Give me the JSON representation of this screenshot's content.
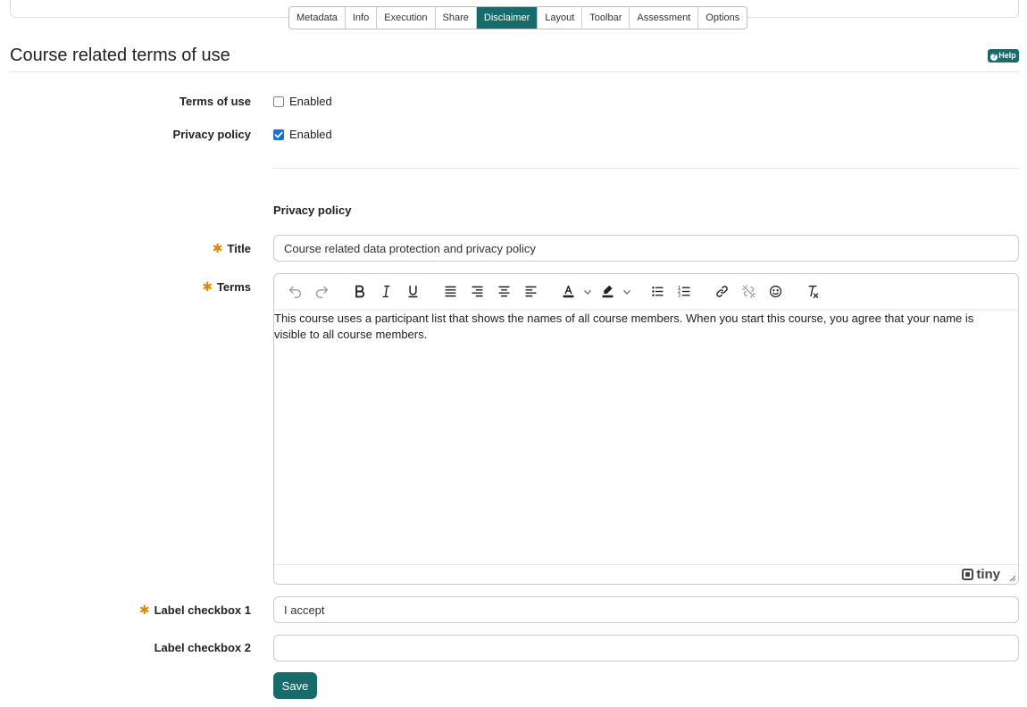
{
  "tabs": [
    {
      "label": "Metadata",
      "active": false
    },
    {
      "label": "Info",
      "active": false
    },
    {
      "label": "Execution",
      "active": false
    },
    {
      "label": "Share",
      "active": false
    },
    {
      "label": "Disclaimer",
      "active": true
    },
    {
      "label": "Layout",
      "active": false
    },
    {
      "label": "Toolbar",
      "active": false
    },
    {
      "label": "Assessment",
      "active": false
    },
    {
      "label": "Options",
      "active": false
    }
  ],
  "page": {
    "title": "Course related terms of use",
    "help_label": "Help"
  },
  "form": {
    "terms_of_use": {
      "label": "Terms of use",
      "checkbox_label": "Enabled",
      "checked": false
    },
    "privacy_policy": {
      "label": "Privacy policy",
      "checkbox_label": "Enabled",
      "checked": true
    },
    "section_heading": "Privacy policy",
    "title_field": {
      "label": "Title",
      "value": "Course related data protection and privacy policy",
      "required": true
    },
    "terms_field": {
      "label": "Terms",
      "required": true,
      "content": "This course uses a participant list that shows the names of all course members. When you start this course, you agree that your name is visible to all course members."
    },
    "label_checkbox_1": {
      "label": "Label checkbox 1",
      "value": "I accept",
      "required": true
    },
    "label_checkbox_2": {
      "label": "Label checkbox 2",
      "value": "",
      "required": false
    },
    "save_label": "Save"
  },
  "editor": {
    "toolbar_icons": [
      "undo-icon",
      "redo-icon",
      "bold-icon",
      "italic-icon",
      "underline-icon",
      "align-justify-icon",
      "align-right-icon",
      "align-center-icon",
      "align-left-icon",
      "text-color-icon",
      "highlight-icon",
      "bullet-list-icon",
      "numbered-list-icon",
      "link-icon",
      "unlink-icon",
      "emoji-icon",
      "clear-format-icon"
    ],
    "brand": "tiny"
  },
  "colors": {
    "accent": "#176b6b",
    "required": "#e08a00",
    "checkbox_checked": "#1b6ed9"
  }
}
